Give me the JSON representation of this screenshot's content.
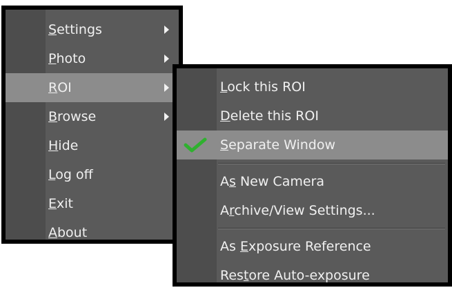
{
  "main_menu": {
    "items": [
      {
        "pre": "",
        "mn": "S",
        "post": "ettings",
        "has_submenu": true
      },
      {
        "pre": "",
        "mn": "P",
        "post": "hoto",
        "has_submenu": true
      },
      {
        "pre": "",
        "mn": "R",
        "post": "OI",
        "has_submenu": true,
        "highlighted": true
      },
      {
        "pre": "",
        "mn": "B",
        "post": "rowse",
        "has_submenu": true
      },
      {
        "pre": "",
        "mn": "H",
        "post": "ide"
      },
      {
        "pre": "",
        "mn": "L",
        "post": "og off"
      },
      {
        "pre": "",
        "mn": "E",
        "post": "xit"
      },
      {
        "pre": "",
        "mn": "A",
        "post": "bout"
      }
    ]
  },
  "roi_submenu": {
    "items": [
      {
        "pre": "",
        "mn": "L",
        "post": "ock this ROI"
      },
      {
        "pre": "",
        "mn": "D",
        "post": "elete this ROI"
      },
      {
        "pre": "",
        "mn": "S",
        "post": "eparate Window",
        "checked": true,
        "highlighted": true
      },
      {
        "pre": "A",
        "mn": "s",
        "post": " New Camera"
      },
      {
        "pre": "A",
        "mn": "r",
        "post": "chive/View Settings..."
      },
      {
        "pre": "As ",
        "mn": "E",
        "post": "xposure Reference"
      },
      {
        "pre": "Res",
        "mn": "t",
        "post": "ore Auto-exposure"
      }
    ],
    "check_icon": "checkmark-icon",
    "check_color": "#2fb12f"
  },
  "colors": {
    "menu_bg": "#5a5a5a",
    "gutter_bg": "#4d4d4d",
    "highlight_bg": "#8c8c8c",
    "border": "#000000",
    "text": "#f0f0f0"
  }
}
